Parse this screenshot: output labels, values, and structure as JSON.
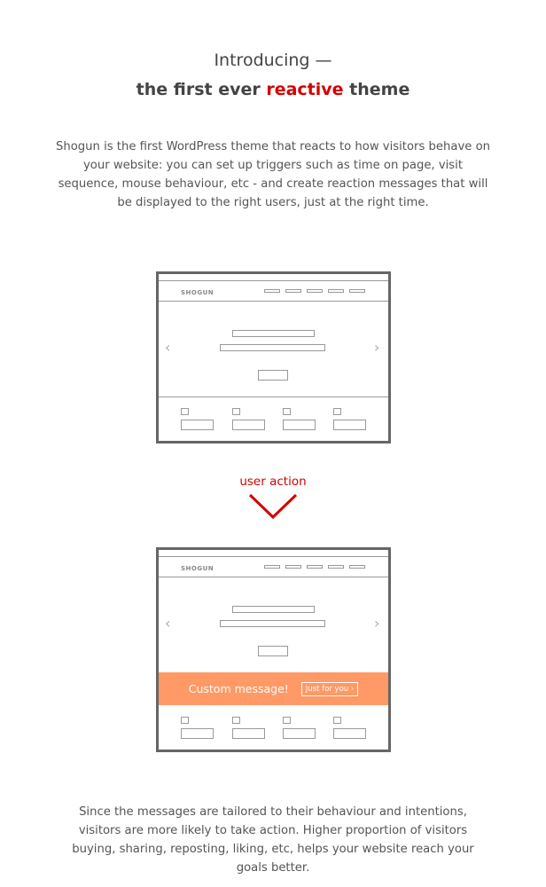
{
  "heading": {
    "line1": "Introducing —",
    "line2_before": "the first ever ",
    "line2_accent": "reactive",
    "line2_after": " theme"
  },
  "intro": "Shogun is the first WordPress theme that reacts to how visitors behave on your website: you can set up triggers such as time on page, visit sequence, mouse behaviour, etc - and create reaction messages that will be displayed to the right users, just at the right time.",
  "mockup": {
    "logo": "SHOGUN",
    "prev": "‹",
    "next": "›"
  },
  "user_action": "user action",
  "banner": {
    "message": "Custom message!",
    "button": "Just for you ›"
  },
  "outro": "Since the messages are tailored to their behaviour and intentions, visitors are more likely to take action. Higher proportion of visitors buying, sharing, reposting, liking, etc, helps your website reach your goals better.",
  "colors": {
    "accent": "#d40000",
    "banner": "#FF9966",
    "frame": "#666666"
  }
}
